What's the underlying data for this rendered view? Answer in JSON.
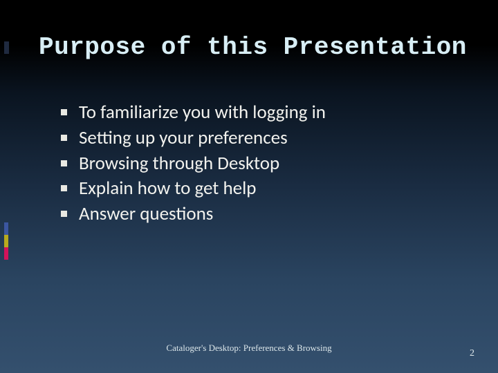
{
  "title": "Purpose of this Presentation",
  "bullets": [
    "To familiarize you with logging in",
    "Setting up your preferences",
    "Browsing through Desktop",
    "Explain how to get help",
    "Answer questions"
  ],
  "footer": "Cataloger's Desktop: Preferences & Browsing",
  "page_number": "2",
  "accent_colors": {
    "top_tab": "#1f2a40",
    "blue": "#3b56a0",
    "yellow": "#b8aa1e",
    "magenta": "#d3135a"
  }
}
